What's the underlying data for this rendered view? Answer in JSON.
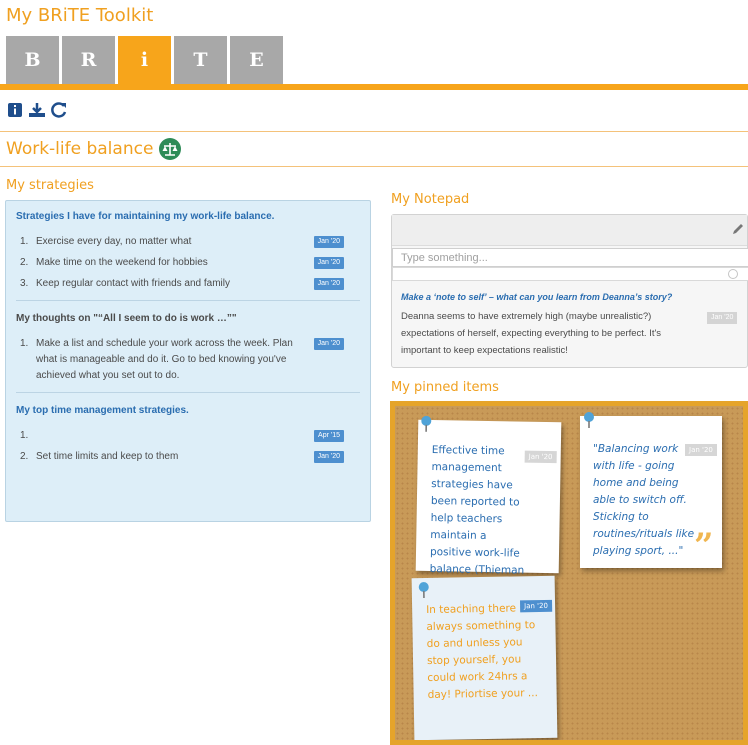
{
  "app": {
    "title": "My BRiTE Toolkit"
  },
  "tabs": [
    {
      "label": "B",
      "active": false
    },
    {
      "label": "R",
      "active": false
    },
    {
      "label": "i",
      "active": true
    },
    {
      "label": "T",
      "active": false
    },
    {
      "label": "E",
      "active": false
    }
  ],
  "toolbar": {
    "icons": [
      "info-icon",
      "download-icon",
      "refresh-icon"
    ]
  },
  "section": {
    "title": "Work-life balance",
    "icon": "balance-scale-icon"
  },
  "strategies": {
    "heading": "My strategies",
    "groups": [
      {
        "title": "Strategies I have for maintaining my work-life balance.",
        "items": [
          {
            "num": "1.",
            "text": "Exercise every day, no matter what",
            "badge": "Jan '20"
          },
          {
            "num": "2.",
            "text": "Make time on the weekend for hobbies",
            "badge": "Jan '20"
          },
          {
            "num": "3.",
            "text": "Keep regular contact with friends and family",
            "badge": "Jan '20"
          }
        ]
      },
      {
        "title": "My thoughts on \"“All I seem to do is work …”\"",
        "items": [
          {
            "num": "1.",
            "text": "Make a list and schedule your work across the week. Plan what is manageable and do it. Go to bed knowing you've achieved what you set out to do.",
            "badge": "Jan '20"
          }
        ]
      },
      {
        "title": "My top time management strategies.",
        "items": [
          {
            "num": "1.",
            "text": "",
            "badge": "Apr '15"
          },
          {
            "num": "2.",
            "text": "Set time limits and keep to them",
            "badge": "Jan '20"
          }
        ]
      }
    ]
  },
  "notepad": {
    "heading": "My Notepad",
    "placeholder": "Type something...",
    "prompt": "Make a ‘note to self’ – what can you learn from Deanna’s story?",
    "body": "Deanna seems to have extremely high (maybe unrealistic?) expectations of herself, expecting everything to be perfect. It's important to keep expectations realistic!",
    "badge": "Jan '20"
  },
  "pinned": {
    "heading": "My pinned items",
    "notes": [
      {
        "text": "Effective time management strategies have been reported to help teachers maintain a positive work-life balance (Thieman ...",
        "badge": "Jan '20"
      },
      {
        "text": "\"Balancing work with life - going home and being able to switch off. Sticking to routines/rituals like playing sport, ...\"",
        "badge": "Jan '20"
      },
      {
        "text": "In teaching there is always something to do and unless you stop yourself, you could work 24hrs a day! Priortise your ...",
        "badge": "Jan '20"
      }
    ]
  },
  "colors": {
    "accent": "#f7a51b",
    "link": "#2a6db0",
    "badge": "#4d8fcf",
    "tab_inactive": "#a8a8a8"
  }
}
